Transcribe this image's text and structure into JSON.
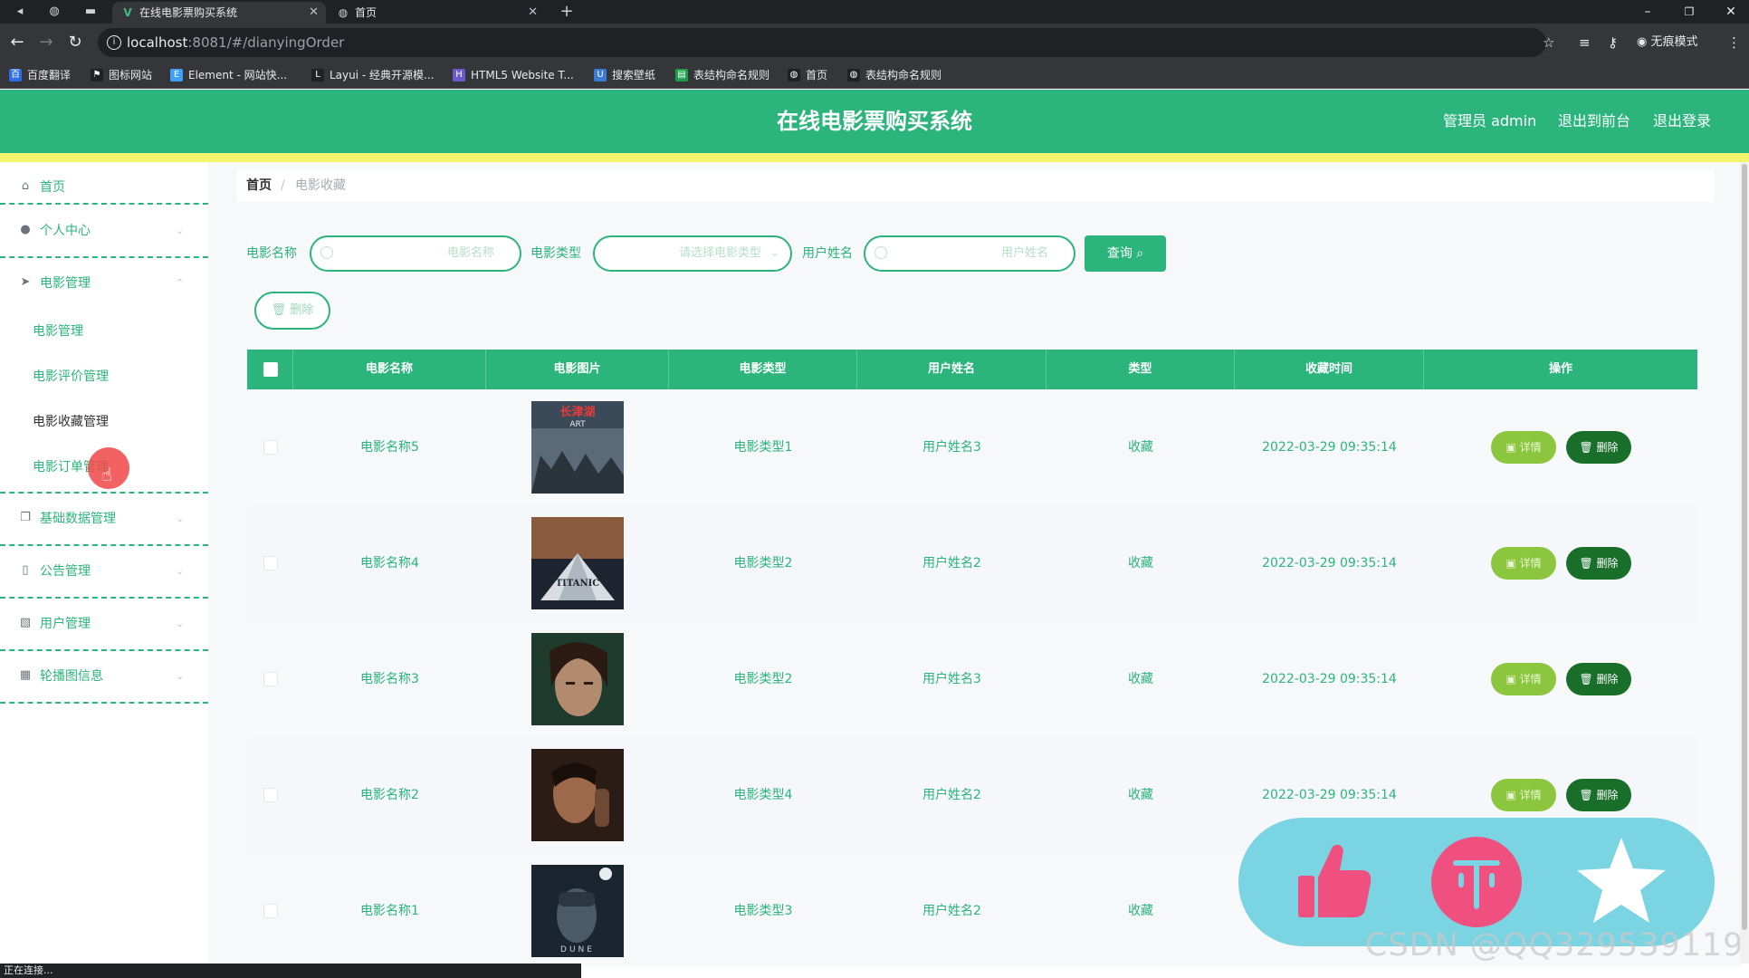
{
  "browser": {
    "tabs": [
      {
        "title": "在线电影票购买系统",
        "favicon": "V"
      },
      {
        "title": "首页",
        "favicon": "◍"
      }
    ],
    "url_host": "localhost",
    "url_rest": ":8081/#/dianyingOrder",
    "profile_label": "无痕模式",
    "bookmarks": [
      {
        "label": "百度翻译",
        "color": "#2f6de1"
      },
      {
        "label": "图标网站",
        "color": "#202124"
      },
      {
        "label": "Element - 网站快...",
        "color": "#409eff"
      },
      {
        "label": "Layui - 经典开源模...",
        "color": "#202124"
      },
      {
        "label": "HTML5 Website T...",
        "color": "#6a5acd"
      },
      {
        "label": "搜索壁纸",
        "color": "#3a7bd5"
      },
      {
        "label": "表结构命名规则",
        "color": "#1e9e4a"
      },
      {
        "label": "首页",
        "color": "#202124"
      },
      {
        "label": "表结构命名规则",
        "color": "#202124"
      }
    ],
    "status": "正在连接..."
  },
  "header": {
    "title": "在线电影票购买系统",
    "admin": "管理员 admin",
    "front": "退出到前台",
    "logout": "退出登录"
  },
  "sidebar": {
    "home": "首页",
    "personal": "个人中心",
    "movie_mgmt": "电影管理",
    "sub_items": [
      "电影管理",
      "电影评价管理",
      "电影收藏管理",
      "电影订单管理"
    ],
    "basic_data": "基础数据管理",
    "notice": "公告管理",
    "user": "用户管理",
    "carousel": "轮播图信息"
  },
  "breadcrumb": {
    "home": "首页",
    "sep": "/",
    "current": "电影收藏"
  },
  "filters": {
    "name_label": "电影名称",
    "name_placeholder": "电影名称",
    "type_label": "电影类型",
    "type_placeholder": "请选择电影类型",
    "user_label": "用户姓名",
    "user_placeholder": "用户姓名",
    "query_label": "查询",
    "delete_label": "删除"
  },
  "table": {
    "headers": [
      "电影名称",
      "电影图片",
      "电影类型",
      "用户姓名",
      "类型",
      "收藏时间",
      "操作"
    ],
    "detail_label": "详情",
    "delete_label": "删除",
    "rows": [
      {
        "name": "电影名称5",
        "type": "电影类型1",
        "user": "用户姓名3",
        "kind": "收藏",
        "time": "2022-03-29 09:35:14"
      },
      {
        "name": "电影名称4",
        "type": "电影类型2",
        "user": "用户姓名2",
        "kind": "收藏",
        "time": "2022-03-29 09:35:14"
      },
      {
        "name": "电影名称3",
        "type": "电影类型2",
        "user": "用户姓名3",
        "kind": "收藏",
        "time": "2022-03-29 09:35:14"
      },
      {
        "name": "电影名称2",
        "type": "电影类型4",
        "user": "用户姓名2",
        "kind": "收藏",
        "time": "2022-03-29 09:35:14"
      },
      {
        "name": "电影名称1",
        "type": "电影类型3",
        "user": "用户姓名2",
        "kind": "收藏",
        "time": ""
      }
    ]
  },
  "watermark": "CSDN @QQ3295391197",
  "colors": {
    "accent": "#2bb47b",
    "yellow": "#f4f46d",
    "detail": "#8cc63e",
    "delete": "#196e29",
    "float": "#7ad4e2"
  }
}
